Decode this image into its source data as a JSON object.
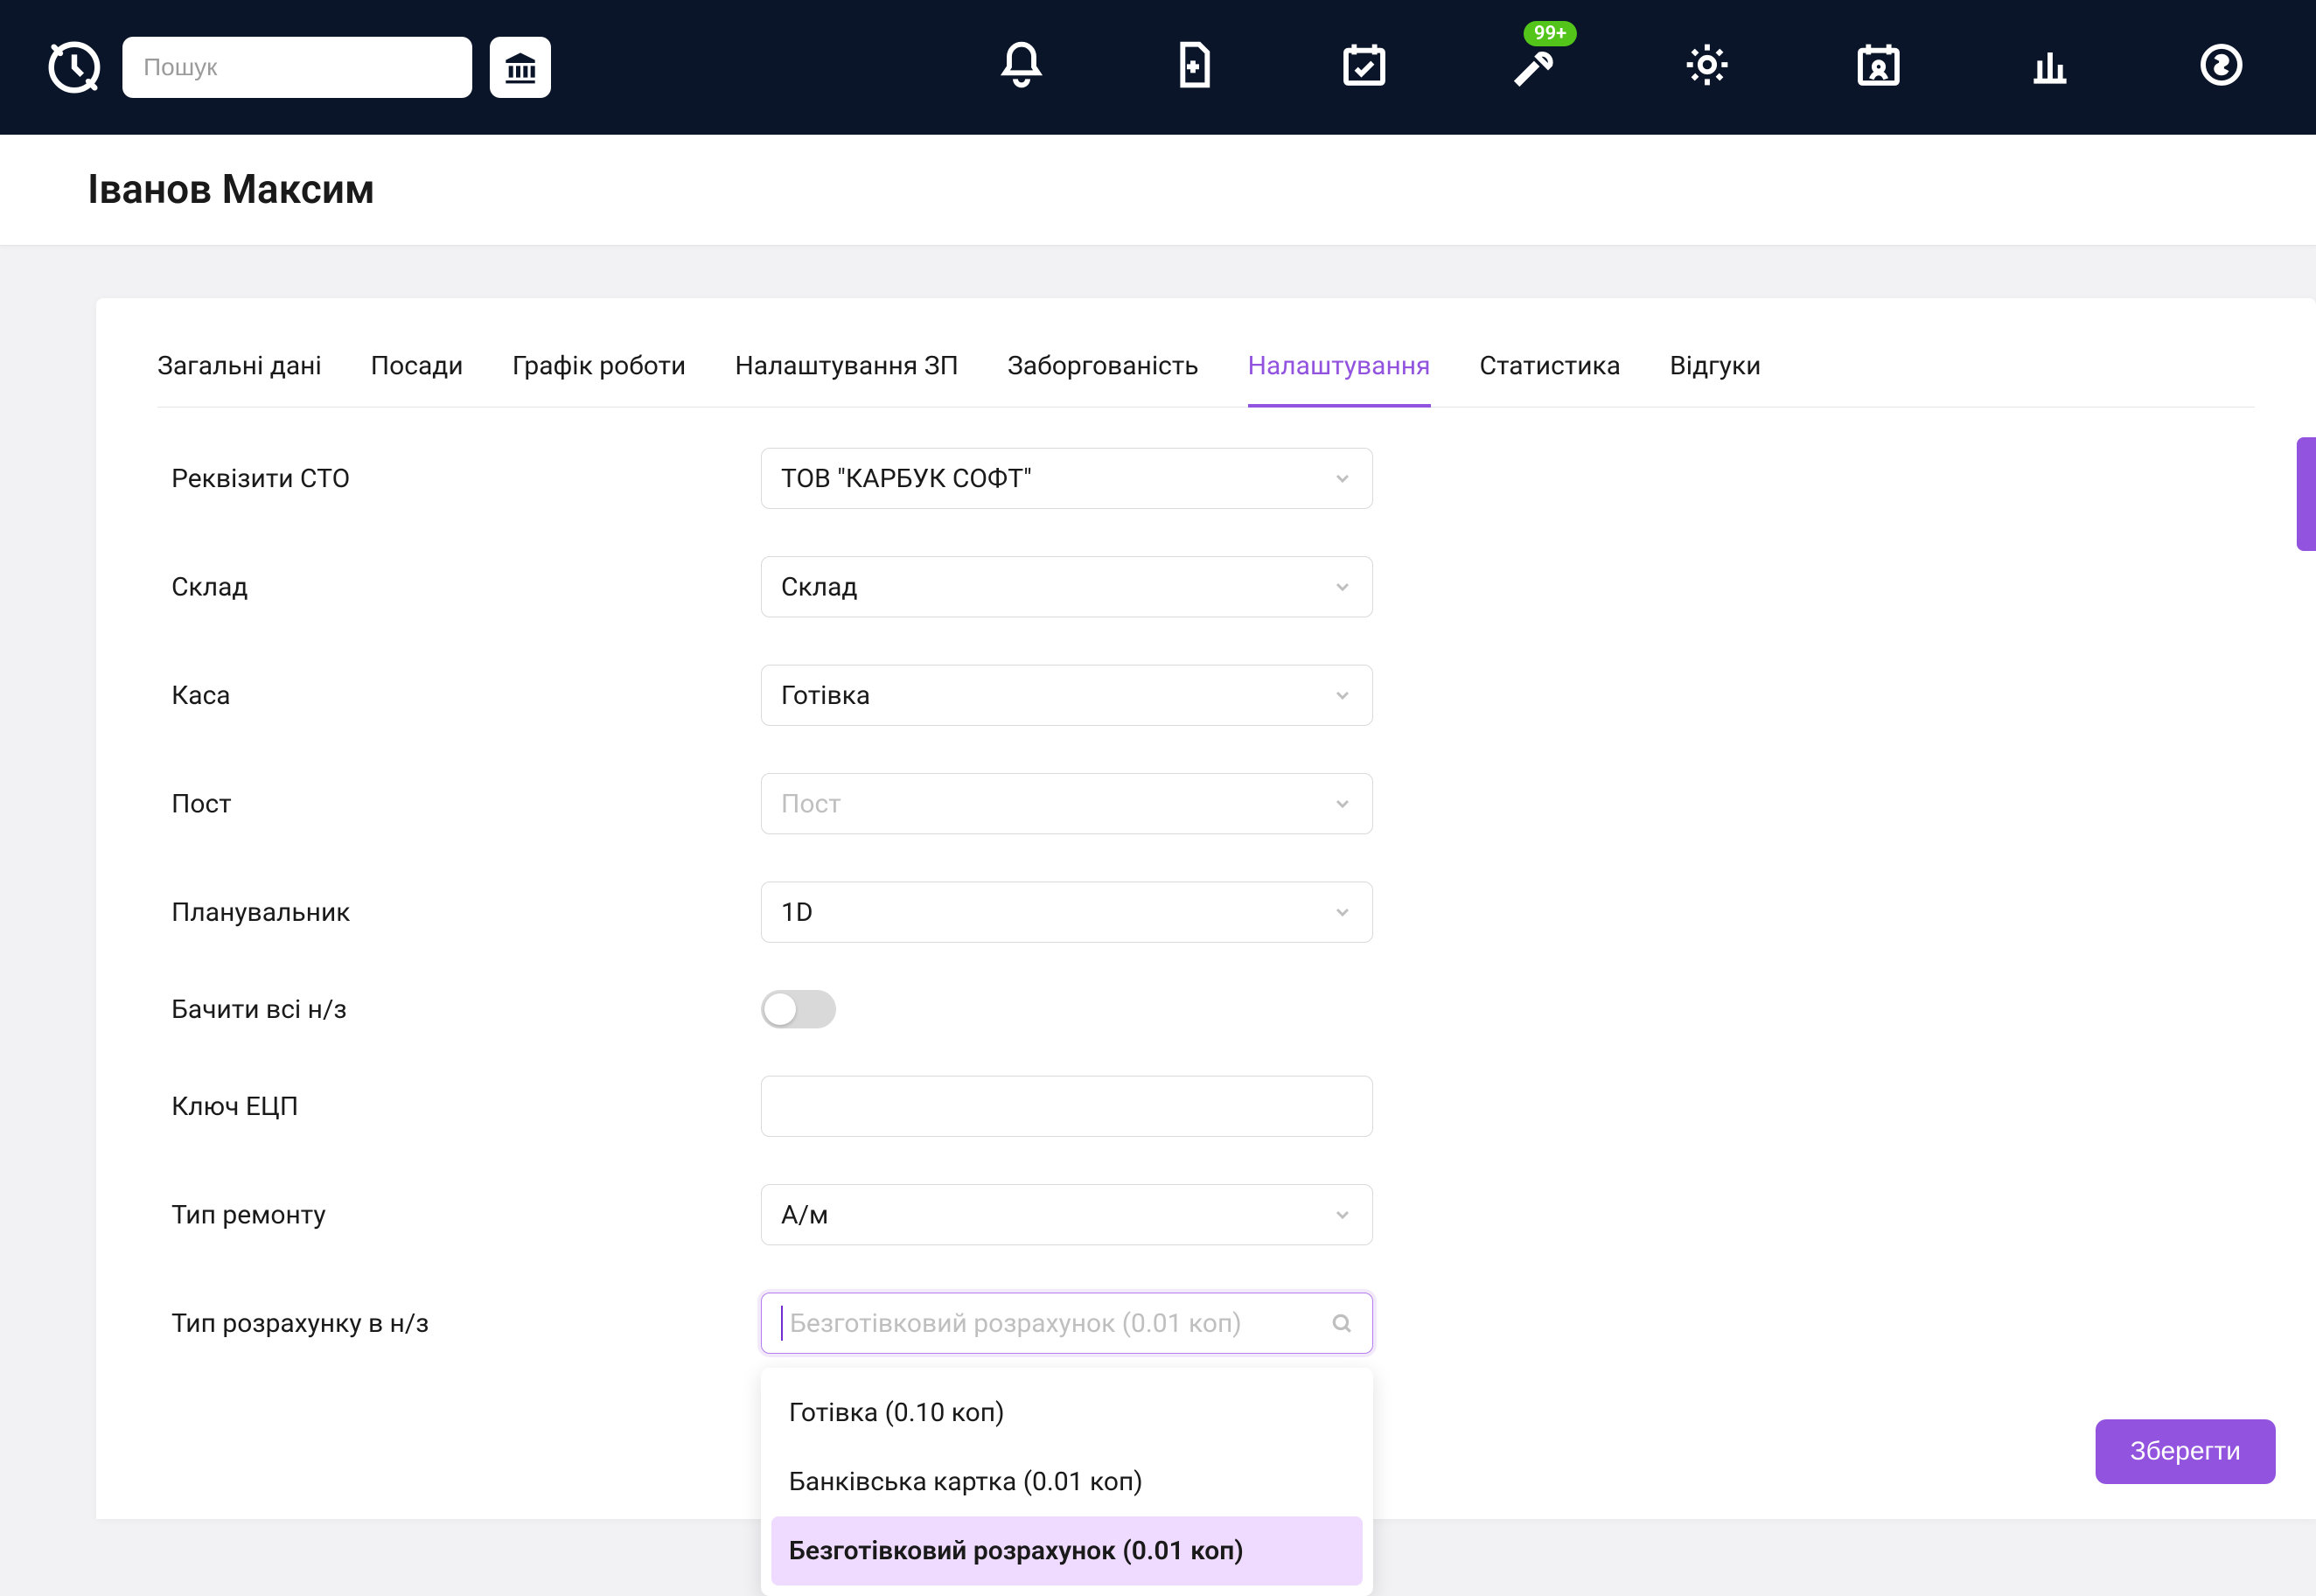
{
  "search": {
    "placeholder": "Пошук"
  },
  "notif_badge": "99+",
  "page_title": "Іванов Максим",
  "tabs": [
    {
      "id": "general",
      "label": "Загальні дані"
    },
    {
      "id": "posts",
      "label": "Посади"
    },
    {
      "id": "schedule",
      "label": "Графік роботи"
    },
    {
      "id": "salary",
      "label": "Налаштування ЗП"
    },
    {
      "id": "debt",
      "label": "Заборгованість"
    },
    {
      "id": "settings",
      "label": "Налаштування"
    },
    {
      "id": "stats",
      "label": "Статистика"
    },
    {
      "id": "reviews",
      "label": "Відгуки"
    }
  ],
  "active_tab": "settings",
  "fields": {
    "requisites": {
      "label": "Реквізити СТО",
      "value": "ТОВ \"КАРБУК СОФТ\""
    },
    "warehouse": {
      "label": "Склад",
      "value": "Склад"
    },
    "cashbox": {
      "label": "Каса",
      "value": "Готівка"
    },
    "post": {
      "label": "Пост",
      "placeholder": "Пост"
    },
    "planner": {
      "label": "Планувальник",
      "value": "1D"
    },
    "see_all": {
      "label": "Бачити всі н/з",
      "value": false
    },
    "eds_key": {
      "label": "Ключ ЕЦП",
      "value": ""
    },
    "repair_type": {
      "label": "Тип ремонту",
      "value": "А/м"
    },
    "calc_type": {
      "label": "Тип розрахунку в н/з",
      "search_placeholder": "Безготівковий розрахунок (0.01 коп)"
    }
  },
  "calc_type_options": [
    {
      "label": "Готівка (0.10 коп)"
    },
    {
      "label": "Банківська картка (0.01 коп)"
    },
    {
      "label": "Безготівковий розрахунок (0.01 коп)",
      "selected": true
    }
  ],
  "save_label": "Зберегти"
}
